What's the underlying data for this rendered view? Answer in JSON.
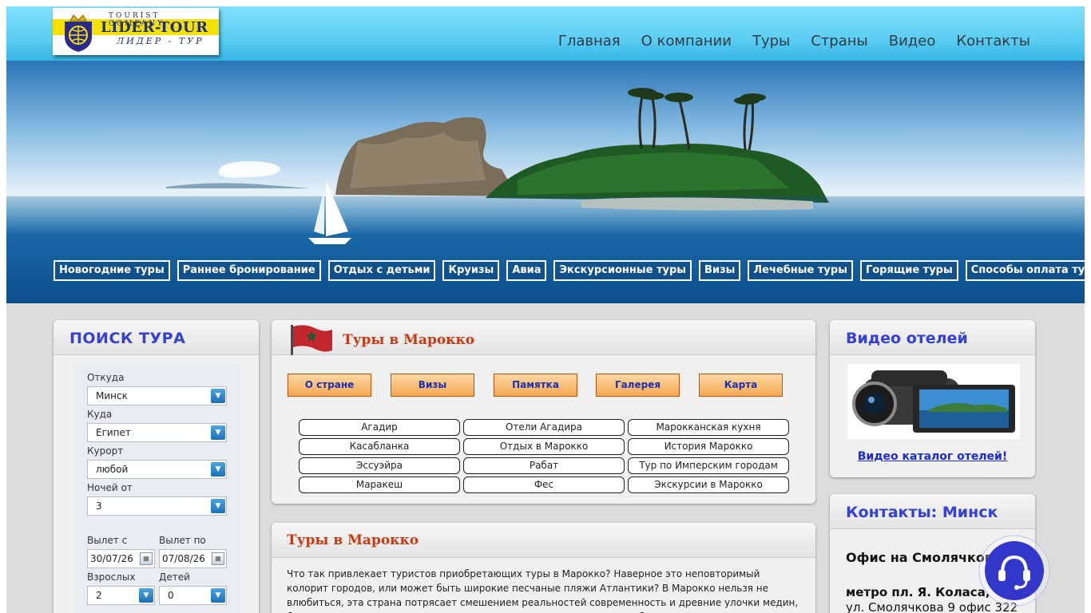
{
  "logo": {
    "company": "TOURIST COMPANY",
    "name": "LIDER-TOUR",
    "sub": "ЛИДЕР - ТУР"
  },
  "nav": [
    "Главная",
    "О компании",
    "Туры",
    "Страны",
    "Видео",
    "Контакты"
  ],
  "subnav": [
    "Новогодние туры",
    "Раннее бронирование",
    "Отдых с детьми",
    "Круизы",
    "Авиа",
    "Экскурсионные туры",
    "Визы",
    "Лечебные туры",
    "Горящие туры",
    "Способы оплата тура"
  ],
  "search": {
    "title": "ПОИСК ТУРА",
    "from_label": "Откуда",
    "from_value": "Минск",
    "to_label": "Куда",
    "to_value": "Египет",
    "resort_label": "Курорт",
    "resort_value": "любой",
    "nights_label": "Ночей от",
    "nights_value": "3",
    "depart_from_label": "Вылет с",
    "depart_from_value": "30/07/26",
    "depart_to_label": "Вылет по",
    "depart_to_value": "07/08/26",
    "adults_label": "Взрослых",
    "adults_value": "2",
    "children_label": "Детей",
    "children_value": "0"
  },
  "morocco": {
    "title": "Туры в Марокко",
    "buttons": [
      "О стране",
      "Визы",
      "Памятка",
      "Галерея",
      "Карта"
    ],
    "links": [
      [
        "Агадир",
        "Отели Агадира",
        "Марокканская кухня"
      ],
      [
        "Касабланка",
        "Отдых в Марокко",
        "История Марокко"
      ],
      [
        "Эссуэйра",
        "Рабат",
        "Тур по Имперским городам"
      ],
      [
        "Маракеш",
        "Фес",
        "Экскурсии в Марокко"
      ]
    ]
  },
  "article": {
    "title": "Туры в Марокко",
    "body": "Что так привлекает туристов приобретающих туры в Марокко? Наверное это неповторимый колорит городов, или может быть широкие песчаные пляжи Атлантики? В Марокко нельзя не влюбиться, эта страна потрясает смешением реальностей современность и древние улочки медин, большие супермаркеты и маленькие лавчонки в которых живут и работают одновременно. Часто"
  },
  "video": {
    "title": "Видео отелей",
    "link": "Видео каталог отелей!"
  },
  "contacts": {
    "title": "Контакты: Минск",
    "office": "Офис на Смолячкова",
    "metro": "метро пл. Я. Коласа,",
    "address": "ул. Смолячкова 9 офис 322"
  },
  "colors": {
    "accent": "#3540d6",
    "heading_red": "#c83a13",
    "header_sky": "#5ccdf2",
    "button_orange": "#f6a653"
  }
}
